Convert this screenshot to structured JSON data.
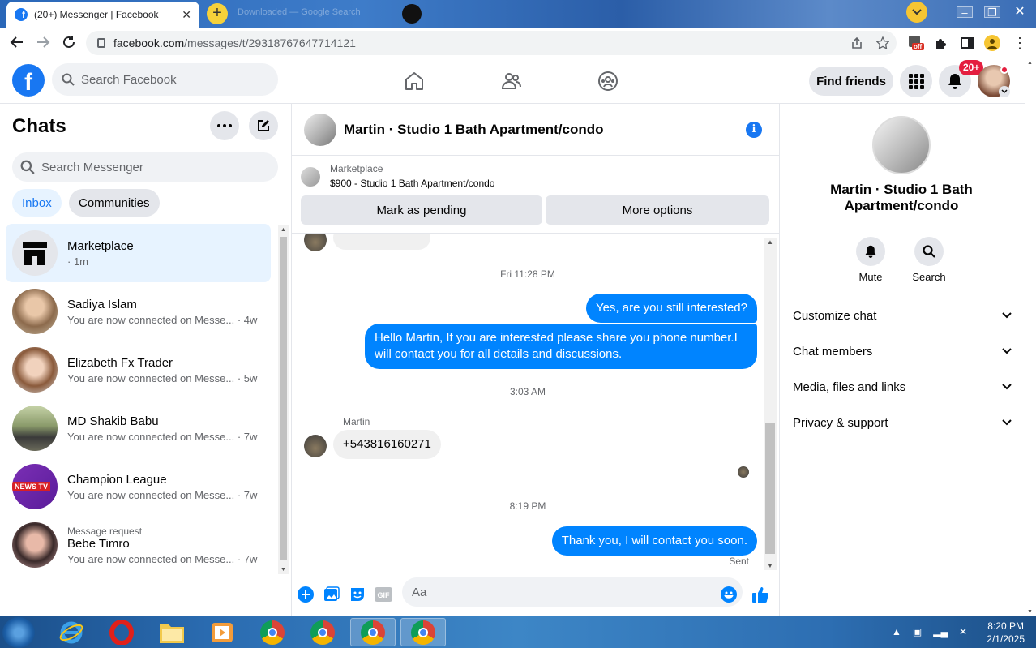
{
  "browser": {
    "tab_title": "(20+) Messenger | Facebook",
    "tab_close": "✕",
    "ghost_tab": "Downloaded — Google Search",
    "new_tab": "+",
    "url_host": "facebook.com",
    "url_path": "/messages/t/29318767647714121",
    "ext_badge": "off"
  },
  "fb_header": {
    "search_placeholder": "Search Facebook",
    "find_friends": "Find friends",
    "notifications_badge": "20+"
  },
  "chats_panel": {
    "title": "Chats",
    "search_placeholder": "Search Messenger",
    "filters": [
      "Inbox",
      "Communities"
    ],
    "items": [
      {
        "name": "Marketplace",
        "sub": "· 1m",
        "request": ""
      },
      {
        "name": "Sadiya Islam",
        "sub": "You are now connected on Messe... · 4w",
        "request": ""
      },
      {
        "name": "Elizabeth Fx Trader",
        "sub": "You are now connected on Messe... · 5w",
        "request": ""
      },
      {
        "name": "MD Shakib Babu",
        "sub": "You are now connected on Messe... · 7w",
        "request": ""
      },
      {
        "name": "Champion League",
        "sub": "You are now connected on Messe... · 7w",
        "request": "",
        "avatar_text": "NEWS TV"
      },
      {
        "name": "Bebe Timro",
        "sub": "You are now connected on Messe... · 7w",
        "request": "Message request"
      }
    ]
  },
  "conversation": {
    "title": "Martin · Studio 1 Bath Apartment/condo",
    "info_icon": "i",
    "marketplace_label": "Marketplace",
    "listing": "$900 - Studio 1 Bath Apartment/condo",
    "mark_pending": "Mark as pending",
    "more_options": "More options",
    "timestamps": [
      "Fri 11:28 PM",
      "3:03 AM",
      "8:19 PM"
    ],
    "msg_out_1": "Yes, are you still interested?",
    "msg_out_2": "Hello Martin, If you are interested please share you phone number.I will contact you for all details and discussions.",
    "sender_name": "Martin",
    "msg_in_1": "+543816160271",
    "msg_out_3": "Thank you, I will contact you soon.",
    "sent_status": "Sent",
    "composer_placeholder": "Aa"
  },
  "info_panel": {
    "name": "Martin · Studio 1 Bath Apartment/condo",
    "mute": "Mute",
    "search": "Search",
    "sections": [
      "Customize chat",
      "Chat members",
      "Media, files and links",
      "Privacy & support"
    ]
  },
  "taskbar": {
    "time": "8:20 PM",
    "date": "2/1/2025"
  },
  "colors": {
    "fb_blue": "#1877f2",
    "messenger_bubble": "#0084ff",
    "active_row": "#e7f3ff",
    "badge_red": "#e41e3f"
  }
}
